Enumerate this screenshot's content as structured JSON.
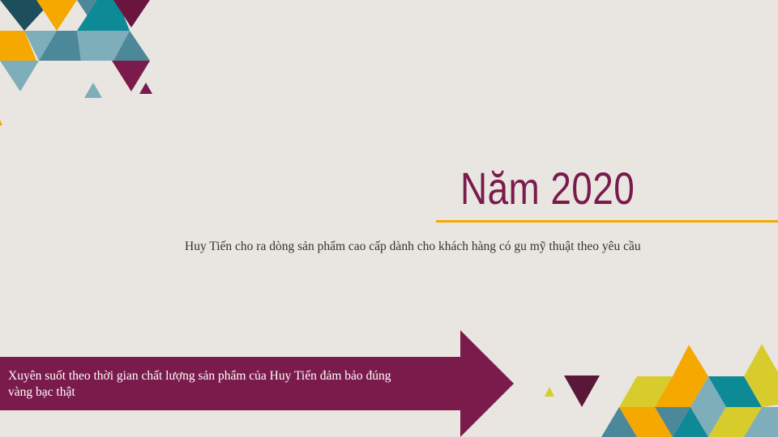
{
  "slide": {
    "title": "Năm 2020",
    "subtitle": "Huy Tiến cho ra dòng sản phẩm cao cấp dành cho khách hàng có gu mỹ thuật theo yêu cầu",
    "arrow_text_line1": "Xuyên suốt theo thời gian chất lượng sản phẩm của Huy Tiến đảm bảo đúng",
    "arrow_text_line2": "vàng bạc thật"
  },
  "colors": {
    "background": "#e9e6e2",
    "plum": "#7a1b4b",
    "gold": "#f5a800",
    "teal": "#0e8a96",
    "slate": "#4c8899",
    "light_blue": "#7faebb",
    "lime": "#d8cc2c",
    "dark_teal": "#1d4e5b"
  }
}
